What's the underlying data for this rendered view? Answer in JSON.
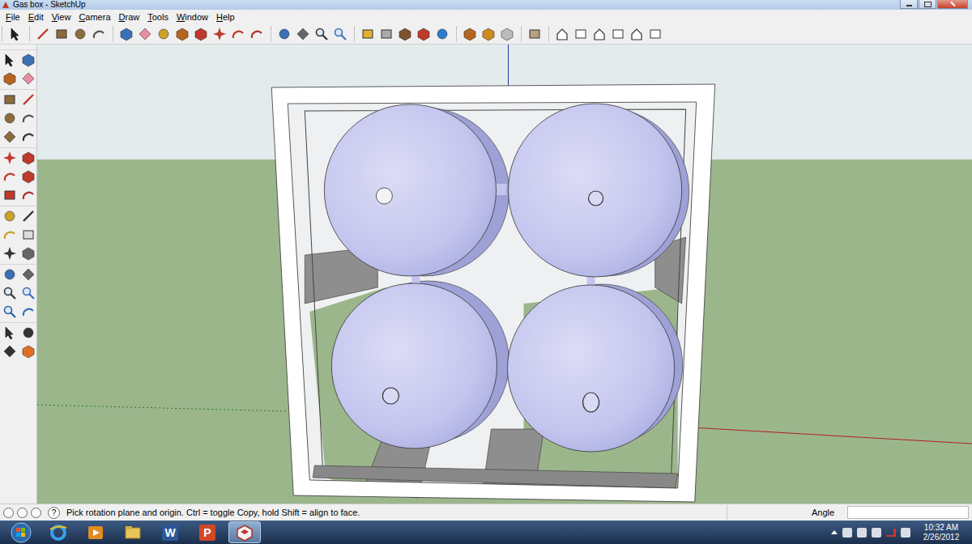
{
  "window": {
    "title": "Gas box - SketchUp"
  },
  "menu": [
    "File",
    "Edit",
    "View",
    "Camera",
    "Draw",
    "Tools",
    "Window",
    "Help"
  ],
  "status_bar": {
    "help_icon": "?",
    "hint": "Pick rotation plane and origin. Ctrl = toggle Copy, hold Shift = align to face.",
    "measurement_label": "Angle"
  },
  "taskbar": {
    "apps": [
      {
        "kind": "ie",
        "selected": false
      },
      {
        "kind": "media",
        "selected": false
      },
      {
        "kind": "explorer",
        "selected": false
      },
      {
        "kind": "word",
        "letter": "W",
        "selected": false
      },
      {
        "kind": "powerpoint",
        "letter": "P",
        "selected": false
      },
      {
        "kind": "sketchup",
        "selected": true
      }
    ],
    "clock": {
      "time": "10:32 AM",
      "date": "2/26/2012"
    }
  }
}
